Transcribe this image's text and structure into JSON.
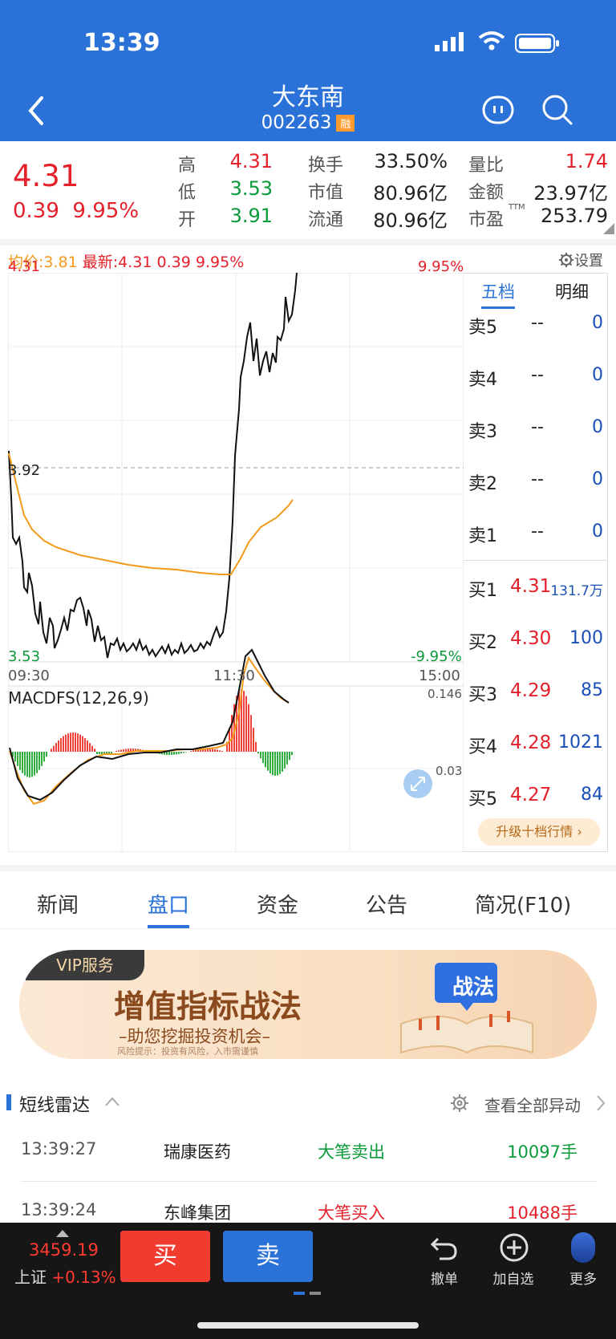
{
  "status": {
    "time": "13:39"
  },
  "header": {
    "title": "大东南",
    "code": "002263",
    "badge": "融"
  },
  "quote": {
    "price": "4.31",
    "change": "0.39",
    "pct": "9.95%",
    "grid": [
      {
        "l": "高",
        "v": "4.31",
        "vc": "red"
      },
      {
        "l": "换手",
        "v": "33.50%",
        "vc": "dark"
      },
      {
        "l": "量比",
        "v": "1.74",
        "vc": "red"
      },
      {
        "l": "低",
        "v": "3.53",
        "vc": "green"
      },
      {
        "l": "市值",
        "v": "80.96亿",
        "vc": "dark"
      },
      {
        "l": "金额",
        "v": "23.97亿",
        "vc": "dark"
      },
      {
        "l": "开",
        "v": "3.91",
        "vc": "green"
      },
      {
        "l": "流通",
        "v": "80.96亿",
        "vc": "dark"
      },
      {
        "l": "市盈",
        "v": "253.79",
        "vc": "dark"
      }
    ],
    "ttm": "TTM"
  },
  "chart": {
    "avg": "均价:3.81",
    "latest": "最新:4.31",
    "chg": "0.39",
    "pct": "9.95%",
    "settings": "设置",
    "top_price": "4.31",
    "top_pct": "9.95%",
    "mid": "3.92",
    "low_price": "3.53",
    "low_pct": "-9.95%",
    "t1": "09:30",
    "t2": "11:30",
    "t3": "15:00",
    "macd_label": "MACDFS(12,26,9)",
    "macd_top": "0.146",
    "macd_mid": "0.03"
  },
  "orderbook": {
    "tab1": "五档",
    "tab2": "明细",
    "sells": [
      {
        "l": "卖5",
        "p": "--",
        "v": "0"
      },
      {
        "l": "卖4",
        "p": "--",
        "v": "0"
      },
      {
        "l": "卖3",
        "p": "--",
        "v": "0"
      },
      {
        "l": "卖2",
        "p": "--",
        "v": "0"
      },
      {
        "l": "卖1",
        "p": "--",
        "v": "0"
      }
    ],
    "buys": [
      {
        "l": "买1",
        "p": "4.31",
        "v": "131.7万"
      },
      {
        "l": "买2",
        "p": "4.30",
        "v": "100"
      },
      {
        "l": "买3",
        "p": "4.29",
        "v": "85"
      },
      {
        "l": "买4",
        "p": "4.28",
        "v": "1021"
      },
      {
        "l": "买5",
        "p": "4.27",
        "v": "84"
      }
    ],
    "upgrade": "升级十档行情"
  },
  "tabs": [
    "新闻",
    "盘口",
    "资金",
    "公告",
    "简况(F10)"
  ],
  "banner": {
    "vip": "VIP服务",
    "title": "增值指标战法",
    "sub": "–助您挖掘投资机会–",
    "risk": "风险提示：投资有风险，入市需谨慎",
    "badge": "战法"
  },
  "radar": {
    "title": "短线雷达",
    "link": "查看全部异动",
    "rows": [
      {
        "t": "13:39:27",
        "n": "瑞康医药",
        "a": "大笔卖出",
        "q": "10097手",
        "c": "green"
      },
      {
        "t": "13:39:24",
        "n": "东峰集团",
        "a": "大笔买入",
        "q": "10488手",
        "c": "red"
      }
    ]
  },
  "bottom": {
    "index_val": "3459.19",
    "index_name": "上证",
    "index_pct": "+0.13%",
    "buy": "买",
    "sell": "卖",
    "undo": "撤单",
    "add": "加自选",
    "more": "更多"
  }
}
